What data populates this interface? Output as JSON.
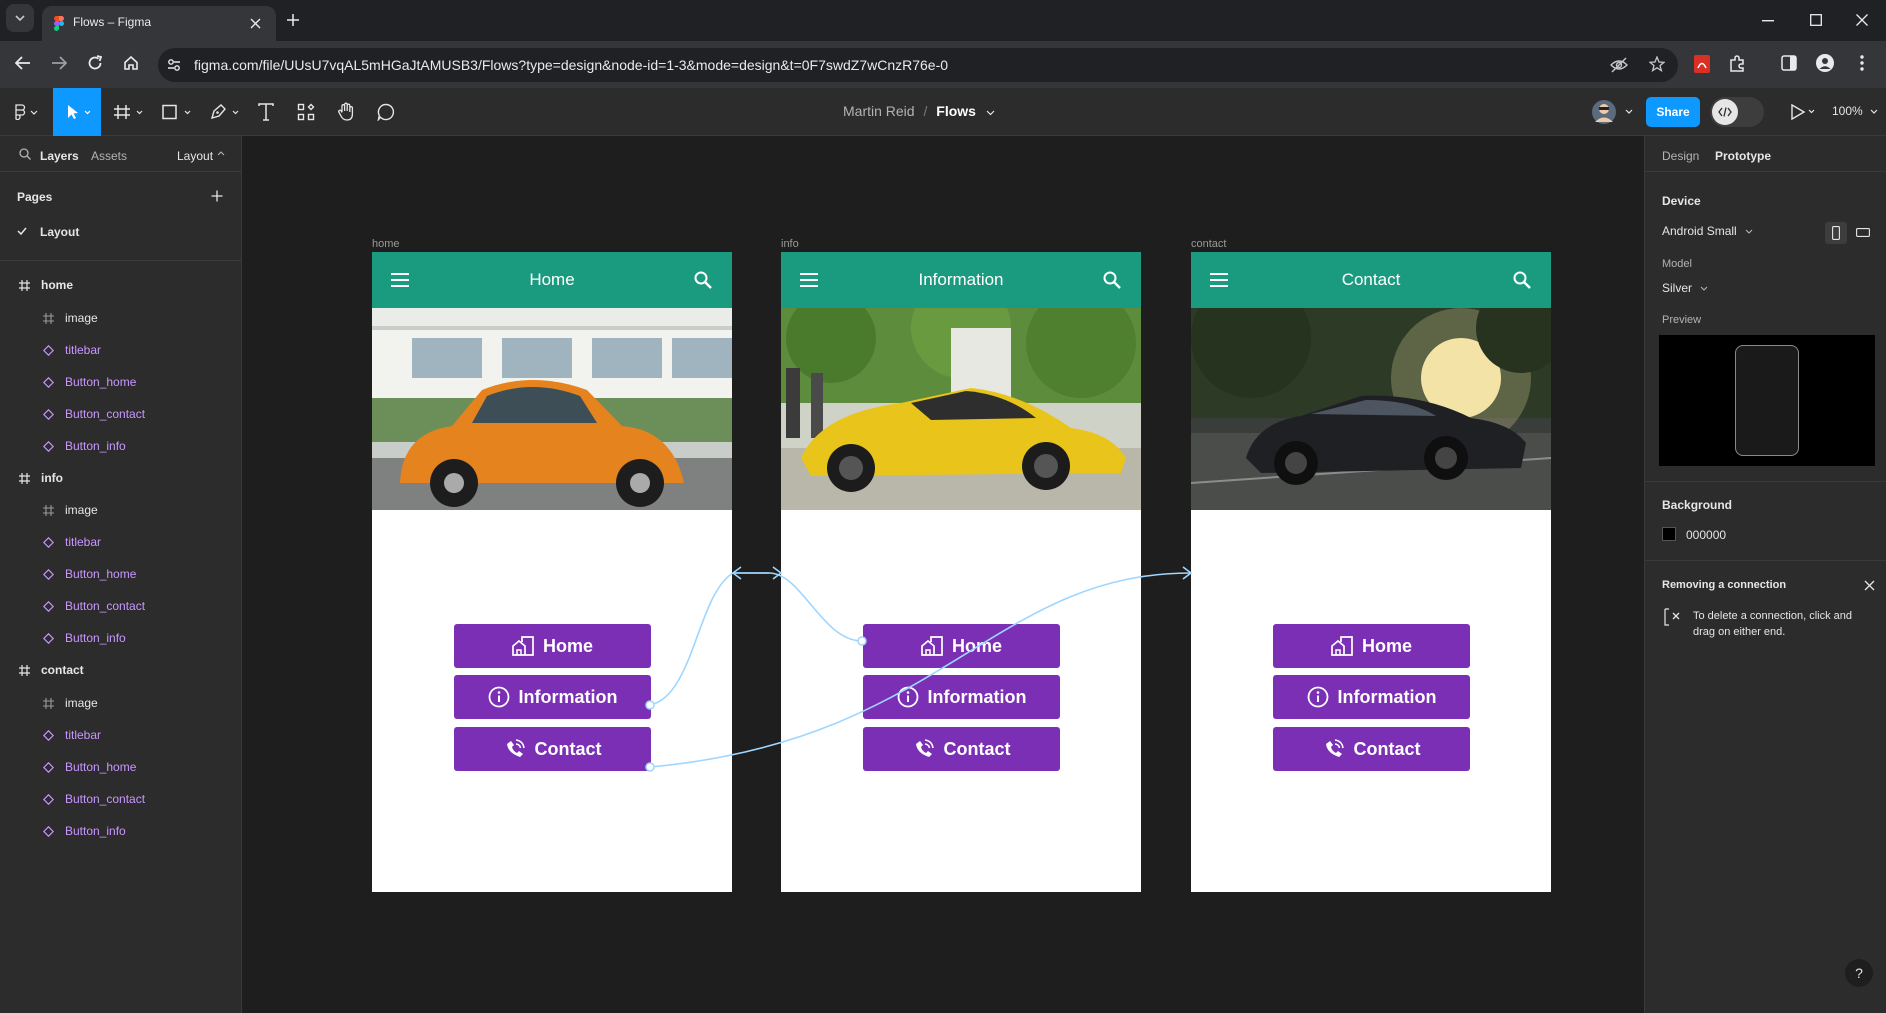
{
  "browser": {
    "tab_title": "Flows – Figma",
    "url": "figma.com/file/UUsU7vqAL5mHGaJtAMUSB3/Flows?type=design&node-id=1-3&mode=design&t=0F7swdZ7wCnzR76e-0"
  },
  "toolbar": {
    "breadcrumb_team": "Martin Reid",
    "breadcrumb_sep": "/",
    "file_name": "Flows",
    "share_label": "Share",
    "zoom": "100%"
  },
  "left_panel": {
    "tabs": [
      "Layers",
      "Assets"
    ],
    "layout_dropdown": "Layout",
    "pages_heading": "Pages",
    "current_page": "Layout",
    "layers": [
      {
        "name": "home",
        "children": [
          "image",
          "titlebar",
          "Button_home",
          "Button_contact",
          "Button_info"
        ]
      },
      {
        "name": "info",
        "children": [
          "image",
          "titlebar",
          "Button_home",
          "Button_contact",
          "Button_info"
        ]
      },
      {
        "name": "contact",
        "children": [
          "image",
          "titlebar",
          "Button_home",
          "Button_contact",
          "Button_info"
        ]
      }
    ]
  },
  "right_panel": {
    "tabs": [
      "Design",
      "Prototype"
    ],
    "device_heading": "Device",
    "device_value": "Android Small",
    "model_label": "Model",
    "model_value": "Silver",
    "preview_label": "Preview",
    "background_heading": "Background",
    "background_value": "000000",
    "hint_title": "Removing a connection",
    "hint_text_line1": "To delete a connection, click and",
    "hint_text_line2": "drag on either end."
  },
  "canvas": {
    "frames": [
      {
        "label": "home",
        "title": "Home",
        "photo": "orange-beetle",
        "buttons": [
          "Home",
          "Information",
          "Contact"
        ]
      },
      {
        "label": "info",
        "title": "Information",
        "photo": "yellow-lamborghini",
        "buttons": [
          "Home",
          "Information",
          "Contact"
        ]
      },
      {
        "label": "contact",
        "title": "Contact",
        "photo": "black-mustang",
        "buttons": [
          "Home",
          "Information",
          "Contact"
        ]
      }
    ]
  },
  "colors": {
    "figma_blue": "#0d99ff",
    "titlebar_teal": "#1a9b80",
    "button_purple": "#7b2fb5",
    "connector_blue": "#9fd6ff",
    "layer_purple": "#c996ff"
  },
  "help_label": "?"
}
